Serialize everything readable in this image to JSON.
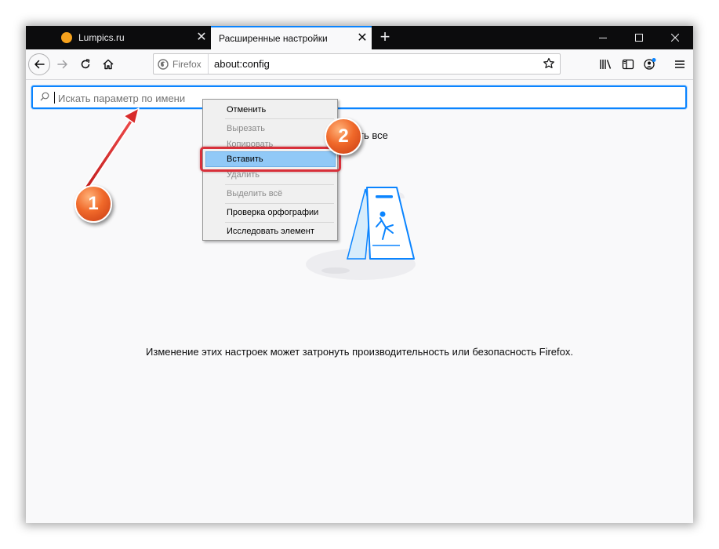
{
  "browser": {
    "tabs": [
      {
        "title": "Lumpics.ru",
        "active": false
      },
      {
        "title": "Расширенные настройки",
        "active": true
      }
    ],
    "tab_close_glyph": "✕",
    "new_tab_glyph": "+",
    "identity_label": "Firefox",
    "url": "about:config",
    "accent_color": "#0a84ff"
  },
  "content": {
    "search_placeholder": "Искать параметр по имени",
    "partial_text": "ть все",
    "warning_text": "Изменение этих настроек может затронуть производительность или безопасность Firefox."
  },
  "context_menu": {
    "items": [
      {
        "label": "Отменить",
        "enabled": true
      },
      {
        "label": "Вырезать",
        "enabled": false
      },
      {
        "label": "Копировать",
        "enabled": false
      },
      {
        "label": "Вставить",
        "enabled": true,
        "highlighted": true
      },
      {
        "label": "Удалить",
        "enabled": false
      },
      {
        "label": "Выделить всё",
        "enabled": false
      },
      {
        "label": "Проверка орфографии",
        "enabled": true
      },
      {
        "label": "Исследовать элемент",
        "enabled": true
      }
    ]
  },
  "annotations": {
    "badge_1": "1",
    "badge_2": "2",
    "badge_color": "#f0692a",
    "highlight_color": "#d8303a"
  }
}
